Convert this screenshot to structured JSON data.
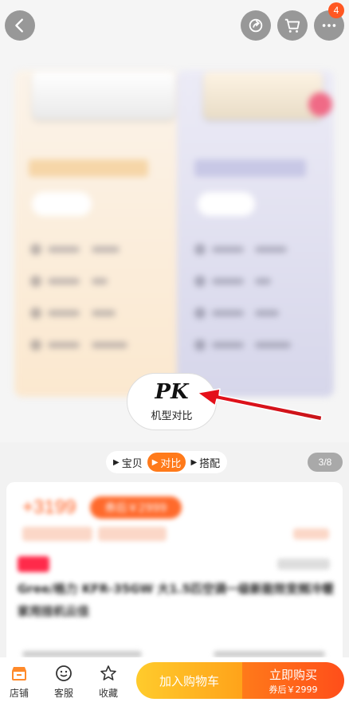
{
  "nav": {
    "back_icon": "chevron-left-icon",
    "share_icon": "share-icon",
    "cart_icon": "cart-icon",
    "more_icon": "more-icon",
    "cart_badge": "4"
  },
  "pk_bubble": {
    "logo": "PK",
    "label": "机型对比"
  },
  "tabs": [
    {
      "label": "宝贝",
      "active": false
    },
    {
      "label": "对比",
      "active": true
    },
    {
      "label": "搭配",
      "active": false
    }
  ],
  "image_counter": "3/8",
  "product": {
    "price": "+3199",
    "price_badge": "券后￥2999",
    "title": "Gree/格力 KFR-35GW 大1.5匹空调一级新能效变频冷暖家用挂机云佳"
  },
  "bottom_bar": {
    "store_label": "店铺",
    "service_label": "客服",
    "favorite_label": "收藏",
    "add_to_cart": "加入购物车",
    "buy_now": "立即购买",
    "buy_now_price": "券后￥2999"
  },
  "colors": {
    "accent": "#ff7a1a",
    "badge": "#ff5722",
    "cart_btn": "#ffb322",
    "buy_btn": "#ff5a1a"
  }
}
